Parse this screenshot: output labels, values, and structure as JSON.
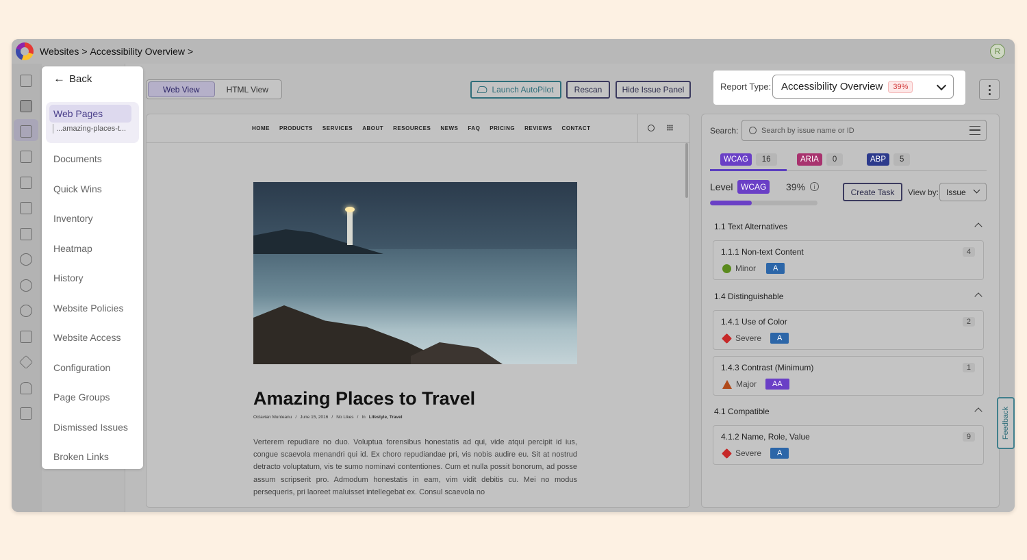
{
  "breadcrumb": {
    "part1": "Websites",
    "sep1": ">",
    "part2": "Accessibility Overview",
    "sep2": ">"
  },
  "user": {
    "avatar_initial": "R"
  },
  "nav": {
    "back_label": "Back",
    "web_pages": {
      "label": "Web Pages",
      "sub": "...amazing-places-t..."
    },
    "items": [
      "Documents",
      "Quick Wins",
      "Inventory",
      "Heatmap",
      "History",
      "Website Policies",
      "Website Access",
      "Configuration",
      "Page Groups",
      "Dismissed Issues",
      "Broken Links"
    ]
  },
  "toolbar": {
    "web_view": "Web View",
    "html_view": "HTML View",
    "launch_autopilot": "Launch AutoPilot",
    "rescan": "Rescan",
    "hide_issue_panel": "Hide Issue Panel"
  },
  "report": {
    "label": "Report Type:",
    "value": "Accessibility Overview",
    "badge": "39%"
  },
  "site": {
    "menu": [
      "HOME",
      "PRODUCTS",
      "SERVICES",
      "ABOUT",
      "RESOURCES",
      "NEWS",
      "FAQ",
      "PRICING",
      "REVIEWS",
      "CONTACT"
    ],
    "article_title": "Amazing Places to Travel",
    "meta": {
      "author": "Octavian Munteanu",
      "date": "June 15, 2016",
      "likes": "No Likes",
      "in": "In",
      "cats": "Lifestyle, Travel"
    },
    "body": "Verterem repudiare no duo. Voluptua forensibus honestatis ad qui, vide atqui percipit id ius, congue scaevola menandri qui id. Ex choro repudiandae pri, vis nobis audire eu. Sit at nostrud detracto voluptatum, vis te sumo nominavi contentiones. Cum et nulla possit bonorum, ad posse assum scripserit pro. Admodum honestatis in eam, vim vidit debitis cu. Mei no modus persequeris, pri laoreet maluisset intellegebat ex. Consul scaevola no"
  },
  "issues": {
    "search_label": "Search:",
    "search_placeholder": "Search by issue name or ID",
    "tabs": [
      {
        "tag": "WCAG",
        "count": "16",
        "color": "#6a3fc6"
      },
      {
        "tag": "ARIA",
        "count": "0",
        "color": "#a8326e"
      },
      {
        "tag": "ABP",
        "count": "5",
        "color": "#2c3a8c"
      }
    ],
    "level_label": "Level",
    "level_tag": "WCAG",
    "level_pct": "39%",
    "level_progress": 0.39,
    "create_task": "Create Task",
    "view_by_label": "View by:",
    "view_by_value": "Issue",
    "groups": [
      {
        "title": "1.1 Text Alternatives"
      },
      {
        "title": "1.4 Distinguishable"
      },
      {
        "title": "4.1 Compatible"
      }
    ],
    "cards": [
      {
        "title": "1.1.1 Non-text Content",
        "count": "4",
        "severity": "Minor",
        "level": "A"
      },
      {
        "title": "1.4.1 Use of Color",
        "count": "2",
        "severity": "Severe",
        "level": "A"
      },
      {
        "title": "1.4.3 Contrast (Minimum)",
        "count": "1",
        "severity": "Major",
        "level": "AA"
      },
      {
        "title": "4.1.2 Name, Role, Value",
        "count": "9",
        "severity": "Severe",
        "level": "A"
      }
    ]
  },
  "feedback": "Feedback"
}
